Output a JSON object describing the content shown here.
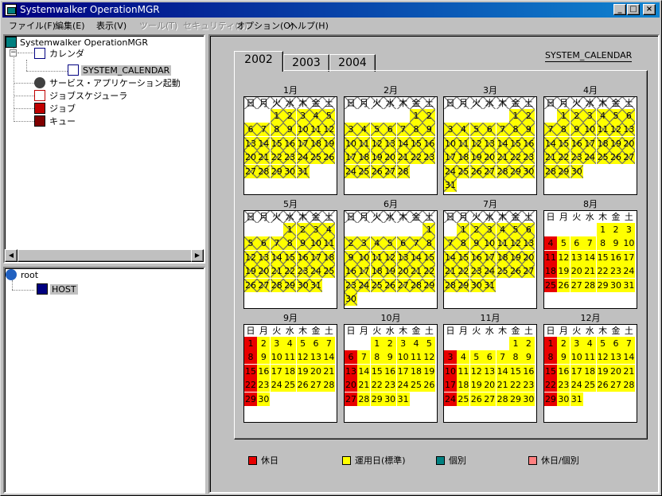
{
  "window": {
    "title": "Systemwalker OperationMGR"
  },
  "menu": [
    {
      "label": "ファイル(F)",
      "disabled": false
    },
    {
      "label": "編集(E)",
      "disabled": false
    },
    {
      "label": "表示(V)",
      "disabled": false
    },
    {
      "label": "ツール(T)",
      "disabled": true
    },
    {
      "label": "セキュリティ(S)",
      "disabled": true
    },
    {
      "label": "オプション(O)",
      "disabled": false
    },
    {
      "label": "ヘルプ(H)",
      "disabled": false
    }
  ],
  "tree": {
    "root": "Systemwalker OperationMGR",
    "calendar": "カレンダ",
    "system_calendar": "SYSTEM_CALENDAR",
    "service": "サービス・アプリケーション起動",
    "scheduler": "ジョブスケジューラ",
    "job": "ジョブ",
    "queue": "キュー"
  },
  "hosts": {
    "root": "root",
    "host": "HOST"
  },
  "years": [
    "2002",
    "2003",
    "2004"
  ],
  "calendar_name": "SYSTEM_CALENDAR",
  "weekdays": [
    "日",
    "月",
    "火",
    "水",
    "木",
    "金",
    "土"
  ],
  "months": [
    {
      "label": "1月",
      "start": 2,
      "days": 31,
      "past": true
    },
    {
      "label": "2月",
      "start": 5,
      "days": 28,
      "past": true
    },
    {
      "label": "3月",
      "start": 5,
      "days": 31,
      "past": true
    },
    {
      "label": "4月",
      "start": 1,
      "days": 30,
      "past": true
    },
    {
      "label": "5月",
      "start": 3,
      "days": 31,
      "past": true
    },
    {
      "label": "6月",
      "start": 6,
      "days": 30,
      "past": true
    },
    {
      "label": "7月",
      "start": 1,
      "days": 31,
      "past": true
    },
    {
      "label": "8月",
      "start": 4,
      "days": 31,
      "past": false
    },
    {
      "label": "9月",
      "start": 0,
      "days": 30,
      "past": false
    },
    {
      "label": "10月",
      "start": 2,
      "days": 31,
      "past": false
    },
    {
      "label": "11月",
      "start": 5,
      "days": 30,
      "past": false
    },
    {
      "label": "12月",
      "start": 0,
      "days": 31,
      "past": false
    }
  ],
  "legend": [
    {
      "label": "休日",
      "color": "#e80000"
    },
    {
      "label": "運用日(標準)",
      "color": "#ffff00"
    },
    {
      "label": "個別",
      "color": "#008080"
    },
    {
      "label": "休日/個別",
      "color": "#ff8080"
    }
  ],
  "colors": {
    "holiday": "#e80000",
    "workday": "#ffff00",
    "titlebar": "#000080"
  }
}
